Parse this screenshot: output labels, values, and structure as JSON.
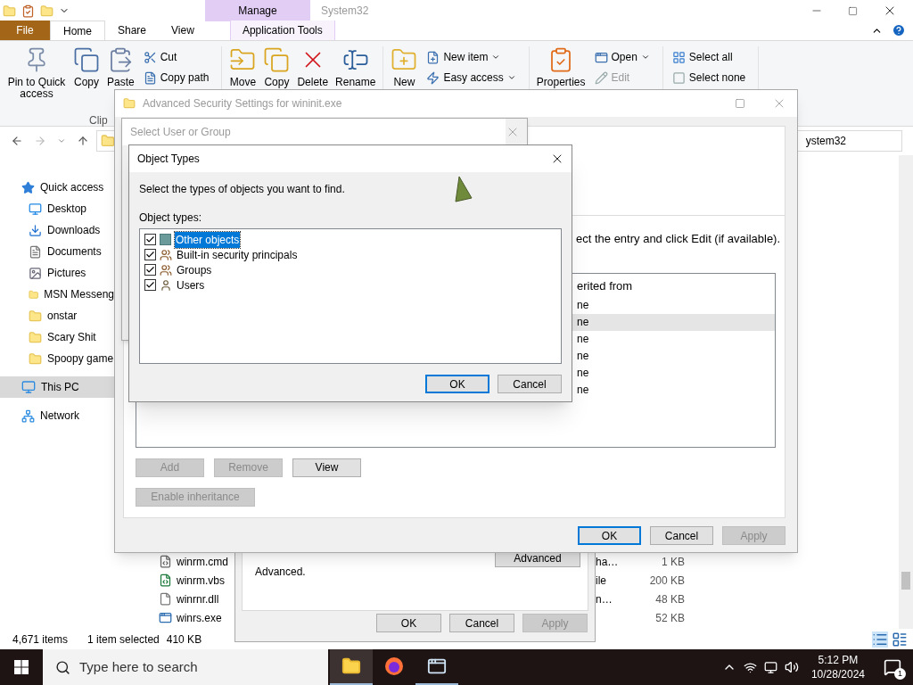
{
  "explorer": {
    "title": "System32",
    "context_header": "Manage",
    "tabs": [
      {
        "label": "File",
        "kind": "file",
        "selected": false
      },
      {
        "label": "Home",
        "kind": "tab",
        "selected": true
      },
      {
        "label": "Share",
        "kind": "tab",
        "selected": false
      },
      {
        "label": "View",
        "kind": "tab",
        "selected": false
      },
      {
        "label": "Application Tools",
        "kind": "context",
        "selected": false
      }
    ],
    "ribbon": [
      {
        "label": "Clip",
        "buttons": [
          {
            "label": "Pin to Quick access",
            "kind": "large",
            "dropdown": false,
            "disabled": false
          },
          {
            "label": "Copy",
            "kind": "large",
            "dropdown": false,
            "disabled": false
          },
          {
            "label": "Paste",
            "kind": "large",
            "dropdown": false,
            "disabled": false
          },
          {
            "label": "Cut",
            "kind": "small",
            "dropdown": false,
            "disabled": false
          },
          {
            "label": "Copy path",
            "kind": "small",
            "dropdown": false,
            "disabled": false
          }
        ]
      },
      {
        "buttons": [
          {
            "label": "Move",
            "kind": "large",
            "dropdown": false,
            "disabled": false
          },
          {
            "label": "Copy",
            "kind": "large",
            "dropdown": false,
            "disabled": false
          },
          {
            "label": "Delete",
            "kind": "large",
            "dropdown": false,
            "disabled": false
          },
          {
            "label": "Rename",
            "kind": "large",
            "dropdown": false,
            "disabled": false
          }
        ]
      },
      {
        "buttons": [
          {
            "label": "New",
            "kind": "large",
            "dropdown": false,
            "disabled": false
          },
          {
            "label": "New item",
            "kind": "small",
            "dropdown": true,
            "disabled": false
          },
          {
            "label": "Easy access",
            "kind": "small",
            "dropdown": true,
            "disabled": false
          }
        ]
      },
      {
        "buttons": [
          {
            "label": "Properties",
            "kind": "large",
            "dropdown": false,
            "disabled": false
          },
          {
            "label": "Open",
            "kind": "small",
            "dropdown": true,
            "disabled": false
          },
          {
            "label": "Edit",
            "kind": "small",
            "dropdown": false,
            "disabled": true
          }
        ]
      },
      {
        "buttons": [
          {
            "label": "Select all",
            "kind": "small",
            "dropdown": false,
            "disabled": false
          },
          {
            "label": "Select none",
            "kind": "small",
            "dropdown": false,
            "disabled": false
          }
        ]
      }
    ],
    "address": "ystem32",
    "sidebar": [
      {
        "label": "Quick access",
        "kind": "star",
        "selected": false,
        "children": [
          {
            "label": "Desktop",
            "kind": "desktop",
            "selected": false
          },
          {
            "label": "Downloads",
            "kind": "download",
            "selected": false
          },
          {
            "label": "Documents",
            "kind": "document",
            "selected": false
          },
          {
            "label": "Pictures",
            "kind": "pictures",
            "selected": false
          },
          {
            "label": "MSN Messeng",
            "kind": "folder",
            "selected": false
          },
          {
            "label": "onstar",
            "kind": "folder",
            "selected": false
          },
          {
            "label": "Scary Shit",
            "kind": "folder",
            "selected": false
          },
          {
            "label": "Spoopy game",
            "kind": "folder",
            "selected": false
          }
        ]
      },
      {
        "label": "This PC",
        "kind": "pc",
        "selected": true
      },
      {
        "label": "Network",
        "kind": "network",
        "selected": false
      }
    ],
    "files": [
      {
        "name": "winrm.cmd",
        "kind": "script",
        "type": "ha…",
        "size": "1 KB"
      },
      {
        "name": "winrm.vbs",
        "kind": "vbs",
        "type": "ile",
        "size": "200 KB"
      },
      {
        "name": "winrnr.dll",
        "kind": "dll",
        "type": "n…",
        "size": "48 KB"
      },
      {
        "name": "winrs.exe",
        "kind": "exe",
        "size": "52 KB"
      }
    ],
    "status": {
      "count": "4,671 items",
      "selection": "1 item selected",
      "selection_size": "410 KB"
    }
  },
  "properties_dialog": {
    "text": "Advanced.",
    "advanced_button": "Advanced",
    "buttons": [
      {
        "label": "OK",
        "default": false,
        "disabled": false
      },
      {
        "label": "Cancel",
        "default": false,
        "disabled": false
      },
      {
        "label": "Apply",
        "default": false,
        "disabled": true
      }
    ]
  },
  "advanced_security": {
    "active": false,
    "title": "Advanced Security Settings for wininit.exe",
    "instruction": "ect the entry and click Edit (if available).",
    "table": {
      "header": "erited from",
      "rows": [
        {
          "cell": "ne",
          "selected": false
        },
        {
          "cell": "ne",
          "selected": true
        },
        {
          "cell": "ne",
          "selected": false
        },
        {
          "cell": "ne",
          "selected": false
        },
        {
          "cell": "ne",
          "selected": false
        },
        {
          "cell": "ne",
          "selected": false
        }
      ]
    },
    "buttons": [
      {
        "label": "Add",
        "disabled": true
      },
      {
        "label": "Remove",
        "disabled": true
      },
      {
        "label": "View",
        "disabled": false
      }
    ],
    "inheritance_button": {
      "label": "Enable inheritance",
      "disabled": true
    },
    "footer_buttons": [
      {
        "label": "OK",
        "default": true,
        "disabled": false
      },
      {
        "label": "Cancel",
        "default": false,
        "disabled": false
      },
      {
        "label": "Apply",
        "default": false,
        "disabled": true
      }
    ]
  },
  "select_user": {
    "active": false,
    "title": "Select User or Group"
  },
  "object_types": {
    "active": true,
    "title": "Object Types",
    "prompt": "Select the types of objects you want to find.",
    "list_label": "Object types:",
    "items": [
      {
        "label": "Other objects",
        "kind": "other",
        "checked": true,
        "selected": true
      },
      {
        "label": "Built-in security principals",
        "kind": "group",
        "checked": true,
        "selected": false
      },
      {
        "label": "Groups",
        "kind": "group",
        "checked": true,
        "selected": false
      },
      {
        "label": "Users",
        "kind": "user",
        "checked": true,
        "selected": false
      }
    ],
    "buttons": [
      {
        "label": "OK",
        "default": true
      },
      {
        "label": "Cancel",
        "default": false
      }
    ]
  },
  "taskbar": {
    "search_placeholder": "Type here to search",
    "apps": [
      {
        "kind": "explorer",
        "selected": true,
        "running": true
      },
      {
        "kind": "firefox",
        "selected": false,
        "running": false
      },
      {
        "kind": "app",
        "selected": false,
        "running": true
      }
    ],
    "time": "5:12 PM",
    "date": "10/28/2024",
    "notifications": "1"
  }
}
